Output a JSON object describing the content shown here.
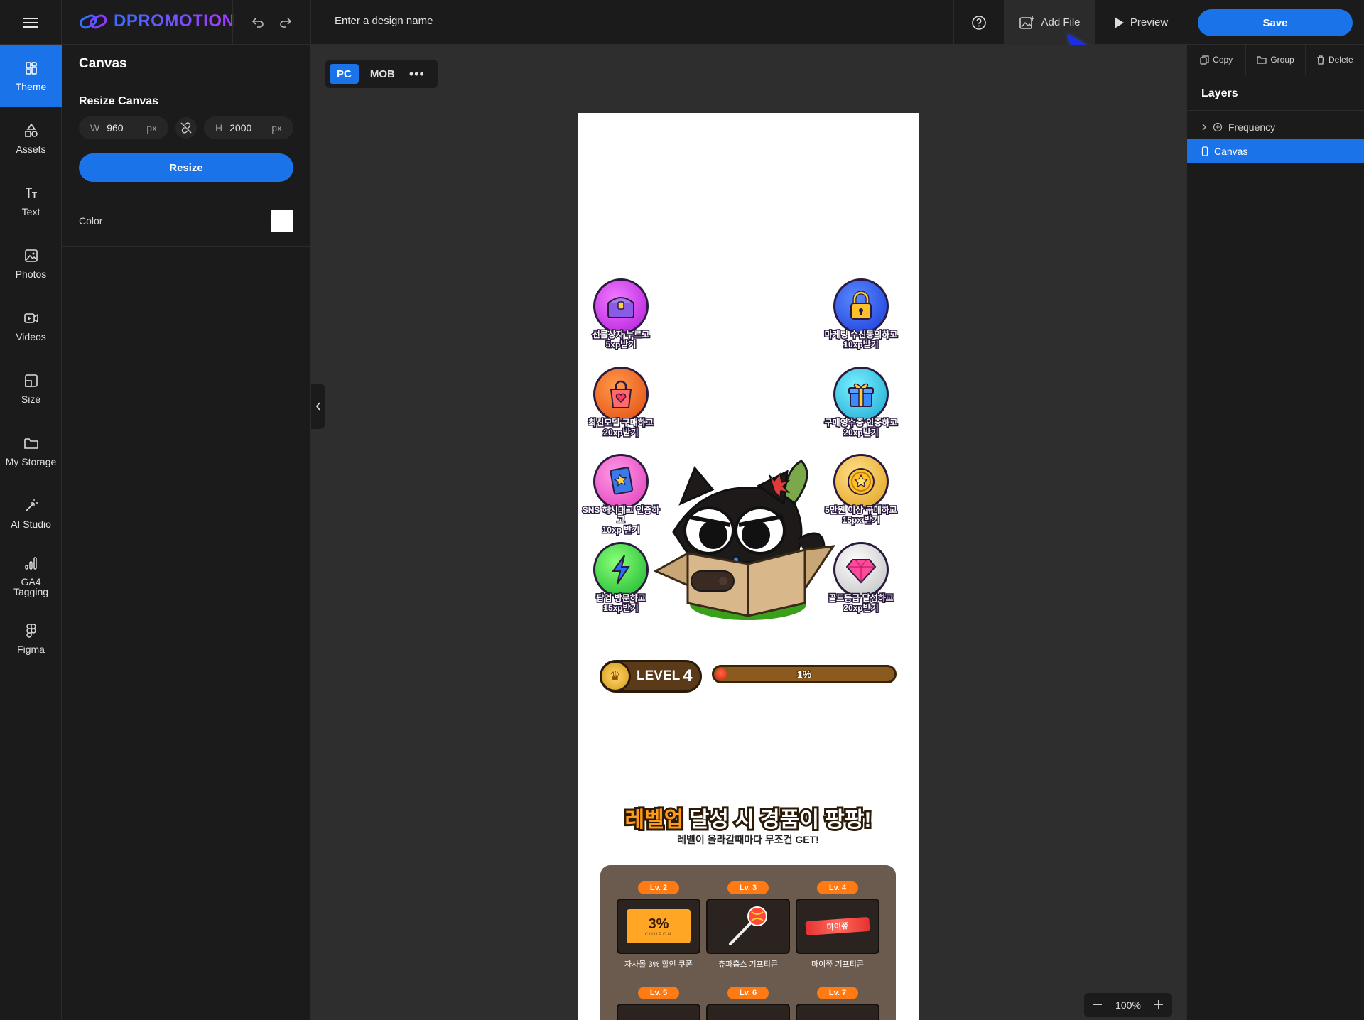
{
  "topbar": {
    "logo": "DPROMOTION",
    "design_name_placeholder": "Enter a design name",
    "add_file": "Add File",
    "preview": "Preview",
    "save": "Save"
  },
  "rail": [
    {
      "label": "Theme",
      "icon": "theme-icon"
    },
    {
      "label": "Assets",
      "icon": "assets-icon"
    },
    {
      "label": "Text",
      "icon": "text-icon"
    },
    {
      "label": "Photos",
      "icon": "photos-icon"
    },
    {
      "label": "Videos",
      "icon": "videos-icon"
    },
    {
      "label": "Size",
      "icon": "size-icon"
    },
    {
      "label": "My Storage",
      "icon": "folder-icon"
    },
    {
      "label": "AI Studio",
      "icon": "magic-wand-icon"
    },
    {
      "label": "GA4 Tagging",
      "icon": "analytics-icon"
    },
    {
      "label": "Figma",
      "icon": "figma-icon"
    }
  ],
  "panel": {
    "title": "Canvas",
    "resize_title": "Resize Canvas",
    "width_label": "W",
    "width_value": "960",
    "height_label": "H",
    "height_value": "2000",
    "unit": "px",
    "resize_button": "Resize",
    "color_label": "Color",
    "color_value": "#ffffff"
  },
  "workspace": {
    "device_pc": "PC",
    "device_mob": "MOB",
    "zoom": "100%"
  },
  "canvas_content": {
    "rewards_left": [
      {
        "line1": "선물상자 누르고",
        "line2": "5xp받기",
        "color": "#c632e6"
      },
      {
        "line1": "최신모델 구매하고",
        "line2": "20xp받기",
        "color": "#f05a1a"
      },
      {
        "line1": "SNS 해시태그 인증하고",
        "line2": "10xp 받기",
        "color": "#ea3fb8"
      },
      {
        "line1": "팝업 방문하고",
        "line2": "15xp받기",
        "color": "#2ecf3a"
      }
    ],
    "rewards_right": [
      {
        "line1": "마케팅 수신동의하고",
        "line2": "10xp받기",
        "color": "#1f5ae6"
      },
      {
        "line1": "구매영수증 인증하고",
        "line2": "20xp받기",
        "color": "#22b0d6"
      },
      {
        "line1": "5만원 이상 구매하고",
        "line2": "15px 받기",
        "color": "#f0b73a"
      },
      {
        "line1": "골드등급 달성하고",
        "line2": "20xp받기",
        "color": "#dcdcdc"
      }
    ],
    "level_label": "LEVEL",
    "level_number": "4",
    "progress_text": "1%",
    "progress_value": 0.01,
    "headline_highlight": "레벨업",
    "headline_rest": " 달성 시 경품이 팡팡!",
    "subline": "레벨이 올라갈때마다 무조건 GET!",
    "prizes": [
      {
        "level": "Lv. 2",
        "name": "자사몰 3% 할인 쿠폰",
        "coupon_value": "3%",
        "coupon_text": "COUPON"
      },
      {
        "level": "Lv. 3",
        "name": "츄파춥스 기프티콘"
      },
      {
        "level": "Lv. 4",
        "name": "마이쮸 기프티콘",
        "candy_text": "마이쮸"
      }
    ],
    "prizes_row2": [
      "Lv. 5",
      "Lv. 6",
      "Lv. 7"
    ]
  },
  "right_panel": {
    "copy": "Copy",
    "group": "Group",
    "delete": "Delete",
    "layers_title": "Layers",
    "layers": [
      {
        "label": "Frequency",
        "selected": false
      },
      {
        "label": "Canvas",
        "selected": true
      }
    ]
  }
}
